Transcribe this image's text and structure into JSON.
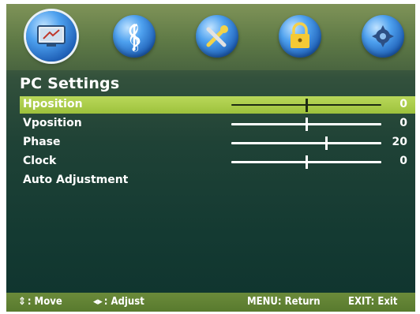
{
  "menu_icons": [
    {
      "name": "picture-icon",
      "selected": true
    },
    {
      "name": "sound-icon",
      "selected": false
    },
    {
      "name": "setup-icon",
      "selected": false
    },
    {
      "name": "lock-icon",
      "selected": false
    },
    {
      "name": "options-icon",
      "selected": false
    }
  ],
  "page": {
    "title": "PC Settings"
  },
  "settings": [
    {
      "label": "Hposition",
      "value": "0",
      "level": 0.5,
      "selected": true
    },
    {
      "label": "Vposition",
      "value": "0",
      "level": 0.5,
      "selected": false
    },
    {
      "label": "Phase",
      "value": "20",
      "level": 0.63,
      "selected": false
    },
    {
      "label": "Clock",
      "value": "0",
      "level": 0.5,
      "selected": false
    },
    {
      "label": "Auto Adjustment",
      "selected": false
    }
  ],
  "footer": {
    "move_label": ": Move",
    "adjust_label": ": Adjust",
    "return_label": "MENU: Return",
    "exit_label": "EXIT: Exit"
  },
  "colors": {
    "highlight": "#a8c94a",
    "footer": "#5f7f33",
    "background": "#1a3d34"
  }
}
